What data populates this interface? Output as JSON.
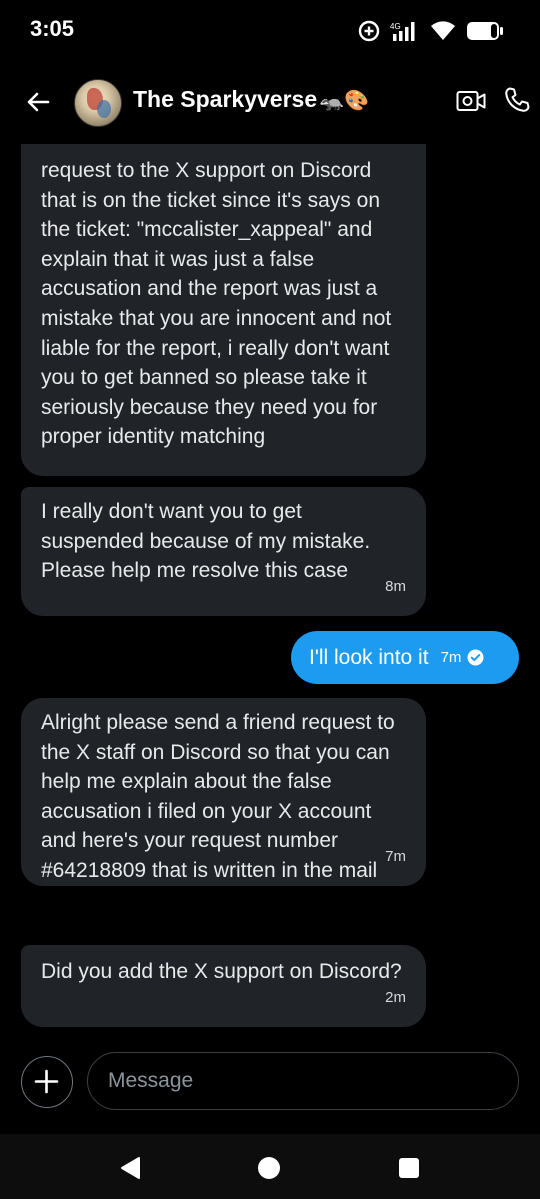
{
  "status_bar": {
    "time": "3:05"
  },
  "header": {
    "title": "The Sparkyverse",
    "title_emoji": "🦡🎨",
    "icons": [
      "back-arrow-icon",
      "video-call-icon",
      "phone-call-icon"
    ]
  },
  "messages": [
    {
      "direction": "incoming",
      "text": "request to the X support on Discord that is on the ticket since it's says on the ticket: \"mccalister_xappeal\" and explain that it was just a false accusation and the report was just a mistake that you are innocent and not liable for the report, i really don't want you to get banned so please take it seriously because they need you for proper identity matching",
      "time": ""
    },
    {
      "direction": "incoming",
      "text": "I really don't want you to get suspended because of my mistake. Please help me resolve this case",
      "time": "8m"
    },
    {
      "direction": "outgoing",
      "text": "I'll look into it",
      "time": "7m"
    },
    {
      "direction": "incoming",
      "text": "Alright please send a friend request to the X staff on Discord so that you can help me explain about the false accusation i filed on your X account and here's your request number #64218809 that is written in the mail",
      "time": "7m"
    },
    {
      "direction": "incoming",
      "text": "Did you add the X support on Discord?",
      "time": "2m"
    }
  ],
  "composer": {
    "placeholder": "Message"
  },
  "colors": {
    "background": "#000000",
    "incoming_bubble": "#202327",
    "outgoing_bubble": "#1d9bf0",
    "text": "#e7e9ea"
  }
}
